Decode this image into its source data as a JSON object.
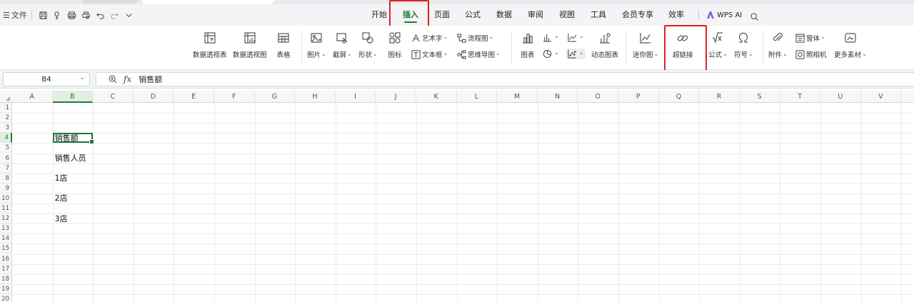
{
  "menubar": {
    "file_label": "文件",
    "wps_ai_label": "WPS AI"
  },
  "tabs": [
    {
      "label": "开始",
      "active": false
    },
    {
      "label": "插入",
      "active": true
    },
    {
      "label": "页面",
      "active": false
    },
    {
      "label": "公式",
      "active": false
    },
    {
      "label": "数据",
      "active": false
    },
    {
      "label": "审阅",
      "active": false
    },
    {
      "label": "视图",
      "active": false
    },
    {
      "label": "工具",
      "active": false
    },
    {
      "label": "会员专享",
      "active": false
    },
    {
      "label": "效率",
      "active": false
    }
  ],
  "ribbon": {
    "pivot_table": "数据透视表",
    "pivot_chart": "数据透视图",
    "table": "表格",
    "picture": "图片",
    "screenshot": "截屏",
    "shape": "形状",
    "icon": "图标",
    "wordart": "艺术字",
    "textbox": "文本框",
    "flowchart": "流程图",
    "mindmap": "思维导图",
    "chart": "图表",
    "dynamic_chart": "动态图表",
    "sparkline": "迷你图",
    "hyperlink": "超链接",
    "formula": "公式",
    "symbol": "符号",
    "attachment": "附件",
    "window": "窗体",
    "camera": "照相机",
    "more": "更多素材"
  },
  "formula_bar": {
    "cell_ref": "B4",
    "fx": "fx",
    "value": "销售额"
  },
  "sheet": {
    "columns": [
      "A",
      "B",
      "C",
      "D",
      "E",
      "F",
      "G",
      "H",
      "I",
      "J",
      "K",
      "L",
      "M",
      "N",
      "O",
      "P",
      "Q",
      "R",
      "S",
      "T",
      "U",
      "V"
    ],
    "rows": [
      "1",
      "2",
      "3",
      "4",
      "5",
      "6",
      "7",
      "8",
      "9",
      "10",
      "11",
      "12",
      "13",
      "14",
      "15",
      "16",
      "17",
      "18",
      "19",
      "20"
    ],
    "selected_col": "B",
    "selected_row": "4",
    "cells": [
      {
        "ref": "B4",
        "text": "销售额"
      },
      {
        "ref": "B6",
        "text": "销售人员"
      },
      {
        "ref": "B8",
        "text": "1店"
      },
      {
        "ref": "B10",
        "text": "2店"
      },
      {
        "ref": "B12",
        "text": "3店"
      }
    ]
  },
  "colors": {
    "accent_green": "#1e7a3a",
    "highlight_red": "#e02020"
  }
}
